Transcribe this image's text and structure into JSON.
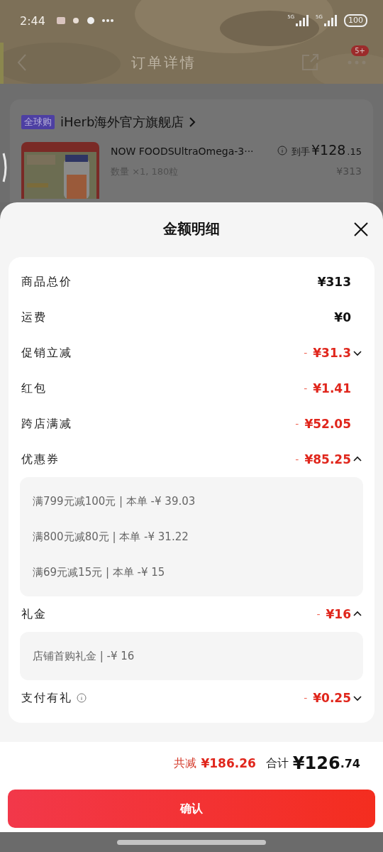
{
  "status_bar": {
    "time": "2:44",
    "battery": "100",
    "network": [
      "5G",
      "5G"
    ]
  },
  "nav": {
    "title": "订单详情",
    "badge": "5+"
  },
  "store_card": {
    "tag": "全球购",
    "store_name": "iHerb海外官方旗舰店",
    "product": {
      "kind": "picture",
      "title": "NOW FOODSUltraOmega-3···",
      "quantity": "数量 ×1, 180粒",
      "price_label": "到手",
      "price_main": "¥128",
      "price_decimal": ".15",
      "original_price": "¥313"
    }
  },
  "sheet": {
    "title": "金额明细",
    "rows": [
      {
        "kind": "plain",
        "label": "商品总价",
        "amount": "¥313"
      },
      {
        "kind": "plain",
        "label": "运费",
        "amount": "¥0"
      },
      {
        "kind": "toggle",
        "label": "促销立减",
        "sign": "-",
        "amount": "¥31.3",
        "expanded": false
      },
      {
        "kind": "discount",
        "label": "红包",
        "sign": "-",
        "amount": "¥1.41"
      },
      {
        "kind": "discount",
        "label": "跨店满减",
        "sign": "-",
        "amount": "¥52.05"
      },
      {
        "kind": "toggle",
        "label": "优惠券",
        "sign": "-",
        "amount": "¥85.25",
        "expanded": true,
        "details": [
          "满799元减100元 | 本单 -¥ 39.03",
          "满800元减80元 | 本单 -¥ 31.22",
          "满69元减15元 | 本单 -¥ 15"
        ]
      },
      {
        "kind": "toggle",
        "label": "礼金",
        "sign": "-",
        "amount": "¥16",
        "expanded": true,
        "details": [
          "店铺首购礼金 | -¥ 16"
        ]
      },
      {
        "kind": "toggle",
        "label": "支付有礼",
        "info": true,
        "sign": "-",
        "amount": "¥0.25",
        "expanded": false
      }
    ]
  },
  "footer": {
    "saved_label": "共减",
    "saved_amount": "¥186.26",
    "total_label": "合计",
    "total_main": "¥126",
    "total_decimal": ".74",
    "confirm": "确认"
  }
}
